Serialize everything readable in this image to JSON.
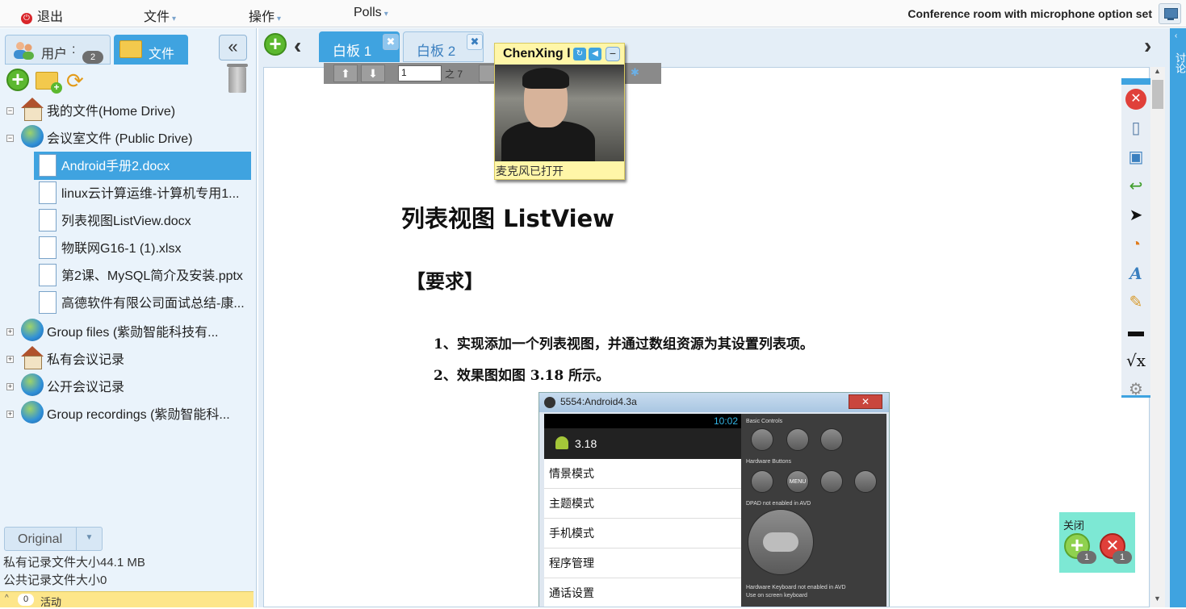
{
  "topbar": {
    "exit_label": "退出",
    "file_menu": "文件",
    "action_menu": "操作",
    "polls_menu": "Polls",
    "conference_title": "Conference room with microphone option set"
  },
  "left_panel": {
    "tab_users_label": "用户",
    "users_count": "2",
    "tab_files_label": "文件",
    "collapse_label": "«",
    "tree": [
      {
        "label": "我的文件(Home Drive)",
        "icon": "home-icon",
        "expander": "−"
      },
      {
        "label": "会议室文件 (Public Drive)",
        "icon": "globe-icon",
        "expander": "−"
      },
      {
        "label": "Android手册2.docx",
        "icon": "document-icon",
        "selected": true
      },
      {
        "label": "linux云计算运维-计算机专用1...",
        "icon": "document-icon"
      },
      {
        "label": "列表视图ListView.docx",
        "icon": "document-icon"
      },
      {
        "label": "物联网G16-1 (1).xlsx",
        "icon": "document-icon"
      },
      {
        "label": "第2课、MySQL简介及安装.pptx",
        "icon": "document-icon"
      },
      {
        "label": "高德软件有限公司面试总结-康...",
        "icon": "document-icon"
      },
      {
        "label": "Group files (紫勋智能科技有...",
        "icon": "globe-icon",
        "expander": "+"
      },
      {
        "label": "私有会议记录",
        "icon": "home-icon",
        "expander": "+"
      },
      {
        "label": "公开会议记录",
        "icon": "globe-icon",
        "expander": "+"
      },
      {
        "label": "Group recordings (紫勋智能科...",
        "icon": "globe-icon",
        "expander": "+"
      }
    ],
    "original_label": "Original",
    "private_size": "私有记录文件大小44.1 MB",
    "public_size": "公共记录文件大小0",
    "activity_count": "0",
    "activity_label": "活动"
  },
  "main": {
    "whiteboard_tabs": [
      {
        "label": "白板 1",
        "active": true
      },
      {
        "label": "白板 2",
        "active": false
      }
    ],
    "page_input": "1",
    "page_of": "之 7",
    "video": {
      "name": "ChenXing l",
      "status": "麦克风已打开"
    },
    "document": {
      "title": "列表视图 ListView",
      "requirement": "【要求】",
      "line1": "1、实现添加一个列表视图，并通过数组资源为其设置列表项。",
      "line2": "2、效果图如图 3.18 所示。"
    },
    "emulator": {
      "window_title": "5554:Android4.3a",
      "time": "10:02",
      "app_title": "3.18",
      "items": [
        "情景模式",
        "主题模式",
        "手机模式",
        "程序管理",
        "通话设置"
      ],
      "basic_controls": "Basic Controls",
      "hardware_buttons": "Hardware Buttons",
      "dpad_note": "DPAD not enabled in AVD",
      "keyboard_note": "Hardware Keyboard not enabled in AVD",
      "keyboard_note2": "Use on screen keyboard",
      "menu_label": "MENU"
    },
    "poll_widget": {
      "close_label": "关闭",
      "add_count": "1",
      "remove_count": "1"
    }
  },
  "right_strip": {
    "text": "讨论"
  }
}
